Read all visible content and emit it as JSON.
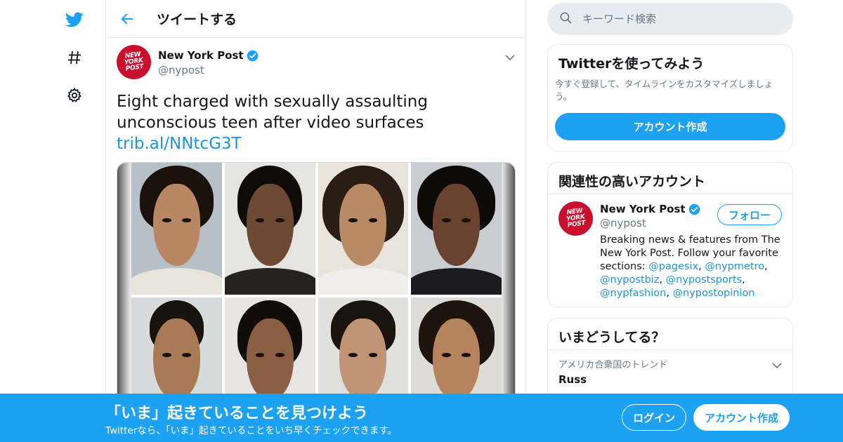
{
  "nav": {
    "icons": [
      "twitter-bird-icon",
      "hashtag-icon",
      "gear-icon"
    ],
    "accent": "#1da1f2"
  },
  "header": {
    "back_icon": "back-arrow-icon",
    "title": "ツイートする"
  },
  "tweet": {
    "author_name": "New York Post",
    "handle": "@nypost",
    "avatar_text": [
      "NEW",
      "YORK",
      "POST"
    ],
    "text": "Eight charged with sexually assaulting unconscious teen after video surfaces ",
    "link": "trib.al/NNtcG3T",
    "media": {
      "description_icon": "mugshot-grid-image",
      "photo_count": 8
    }
  },
  "search": {
    "placeholder": "キーワード検索"
  },
  "signup_card": {
    "title": "Twitterを使ってみよう",
    "description": "今すぐ登録して、タイムラインをカスタマイズしましょう。",
    "button": "アカウント作成"
  },
  "related": {
    "title": "関連性の高いアカウント",
    "account": {
      "name": "New York Post",
      "handle": "@nypost",
      "follow_label": "フォロー",
      "bio_prefix": "Breaking news & features from The New York Post. Follow your favorite sections: ",
      "bio_links": [
        "@pagesix",
        "@nypmetro",
        "@nypostbiz",
        "@nypostsports",
        "@nypfashion",
        "@nypostopinion"
      ]
    }
  },
  "trends": {
    "title": "いまどうしてる？",
    "items": [
      {
        "context": "アメリカ合衆国のトレンド",
        "name": "Russ"
      }
    ]
  },
  "banner": {
    "title": "「いま」起きていることを見つけよう",
    "subtitle": "Twitterなら、「いま」起きていることをいち早くチェックできます。",
    "login": "ログイン",
    "signup": "アカウント作成",
    "color": "#1da1f2"
  }
}
